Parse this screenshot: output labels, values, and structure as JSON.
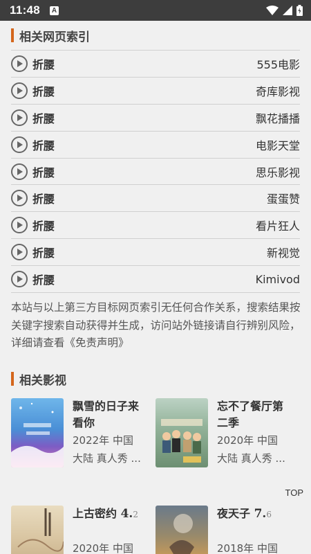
{
  "status_bar": {
    "time": "11:48",
    "badge": "A"
  },
  "related_pages": {
    "heading": "相关网页索引",
    "items": [
      {
        "title": "折腰",
        "source": "555电影"
      },
      {
        "title": "折腰",
        "source": "奇库影视"
      },
      {
        "title": "折腰",
        "source": "飘花播播"
      },
      {
        "title": "折腰",
        "source": "电影天堂"
      },
      {
        "title": "折腰",
        "source": "思乐影视"
      },
      {
        "title": "折腰",
        "source": "蛋蛋赞"
      },
      {
        "title": "折腰",
        "source": "看片狂人"
      },
      {
        "title": "折腰",
        "source": "新视觉"
      },
      {
        "title": "折腰",
        "source": "Kimivod"
      }
    ],
    "disclaimer": "本站与以上第三方目标网页索引无任何合作关系，搜索结果按关键字搜索自动获得并生成，访问站外链接请自行辨别风险，详细请查看《免责声明》"
  },
  "related_videos": {
    "heading": "相关影视",
    "cards": [
      {
        "name": "飘雪的日子来看你",
        "meta1": "2022年 中国",
        "meta2": "大陆 真人秀 ..."
      },
      {
        "name": "忘不了餐厅第二季",
        "meta1": "2020年 中国",
        "meta2": "大陆 真人秀 ..."
      },
      {
        "name": "上古密约",
        "score_int": "4.",
        "score_dec": "2",
        "meta1": "2020年 中国"
      },
      {
        "name": "夜天子",
        "score_int": "7.",
        "score_dec": "6",
        "meta1": "2018年 中国"
      }
    ]
  },
  "top_label": "TOP"
}
